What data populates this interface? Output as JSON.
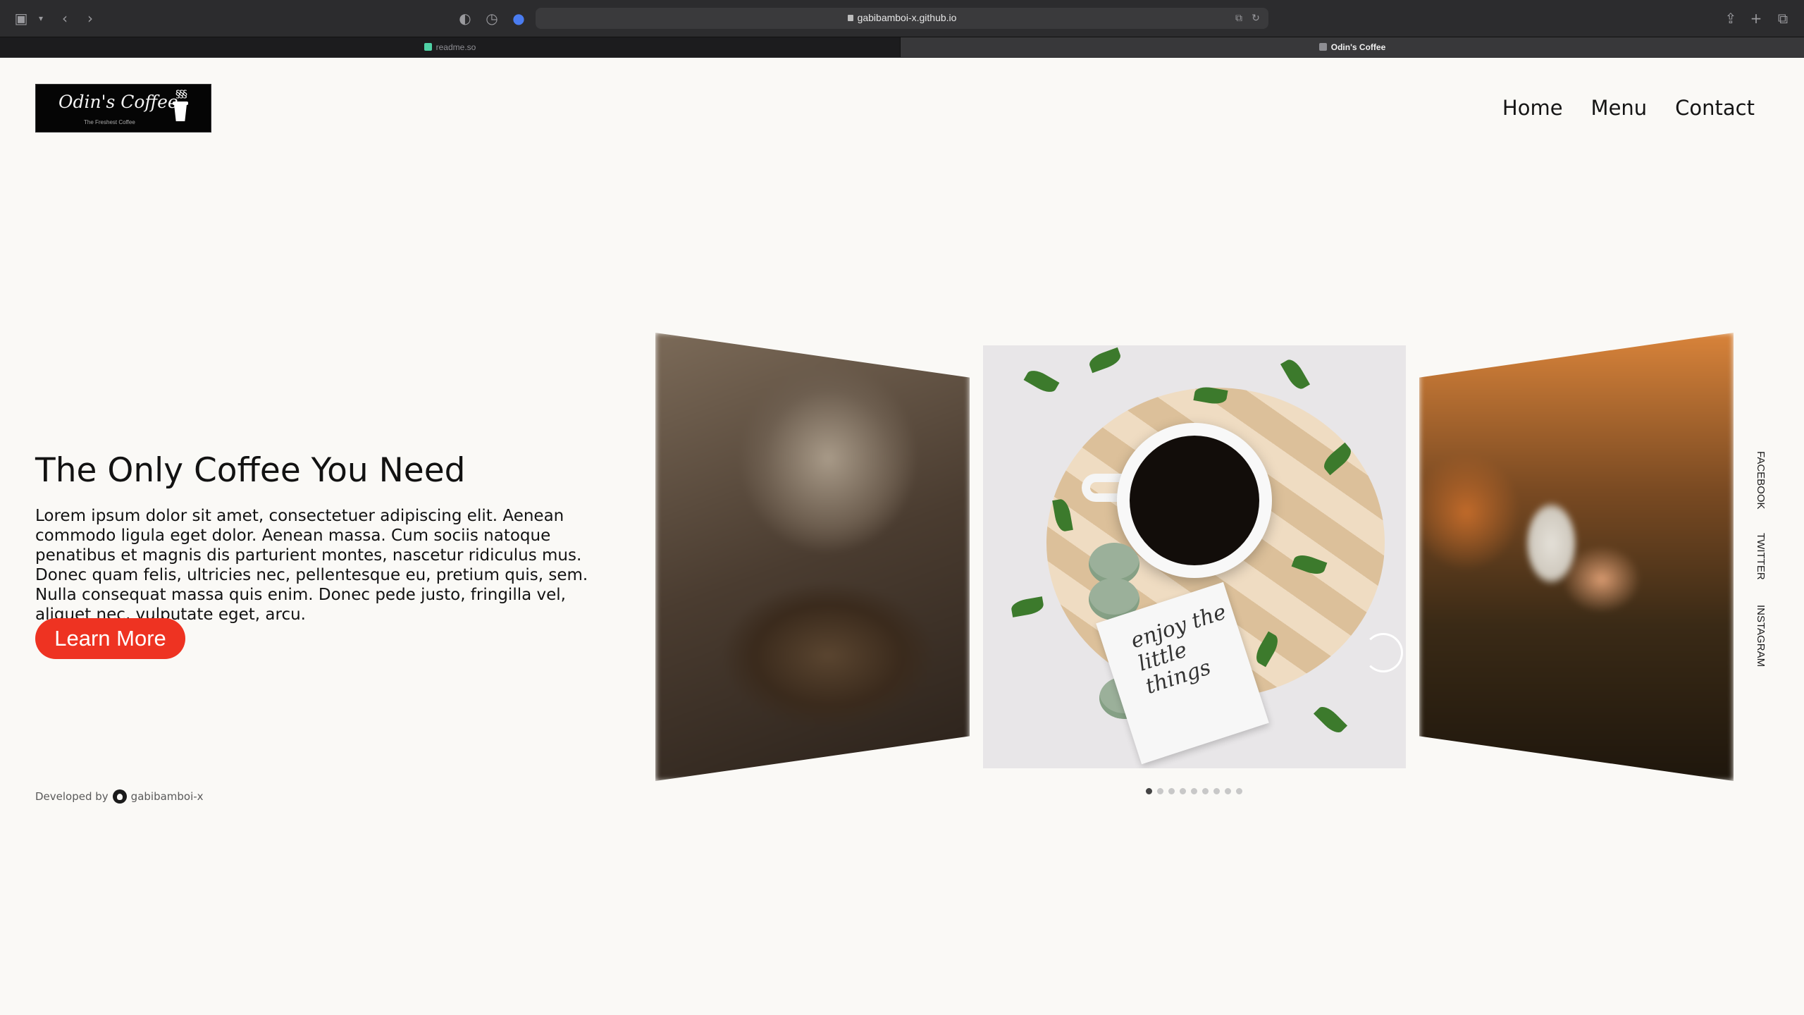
{
  "browser": {
    "url": "gabibamboi-x.github.io",
    "tabs": [
      {
        "title": "readme.so"
      },
      {
        "title": "Odin's Coffee"
      }
    ]
  },
  "logo": {
    "title": "Odin's Coffee",
    "subtitle": "The Freshest Coffee"
  },
  "nav": {
    "items": [
      {
        "label": "Home"
      },
      {
        "label": "Menu"
      },
      {
        "label": "Contact"
      }
    ]
  },
  "hero": {
    "title": "The Only Coffee You Need",
    "body": "Lorem ipsum dolor sit amet, consectetuer adipiscing elit. Aenean commodo ligula eget dolor. Aenean massa. Cum sociis natoque penatibus et magnis dis parturient montes, nascetur ridiculus mus. Donec quam felis, ultricies nec, pellentesque eu, pretium quis, sem. Nulla consequat massa quis enim. Donec pede justo, fringilla vel, aliquet nec, vulputate eget, arcu.",
    "button_label": "Learn More"
  },
  "carousel": {
    "card_text": "enjoy the little things",
    "slide_count": 9,
    "active_index": 0
  },
  "social": {
    "links": [
      {
        "label": "FACEBOOK"
      },
      {
        "label": "TWITTER"
      },
      {
        "label": "INSTAGRAM"
      }
    ]
  },
  "footer": {
    "developed_by": "Developed by",
    "author": "gabibamboi-x"
  },
  "colors": {
    "accent": "#ee3322",
    "background": "#faf9f6",
    "text": "#121212"
  }
}
